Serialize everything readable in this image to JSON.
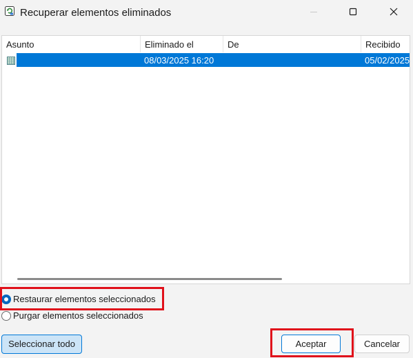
{
  "window": {
    "title": "Recuperar elementos eliminados",
    "icon": "recover-items-icon",
    "controls": [
      "minimize-icon",
      "maximize-icon",
      "close-icon"
    ]
  },
  "list": {
    "columns": [
      "Asunto",
      "Eliminado el",
      "De",
      "Recibido"
    ],
    "rows": [
      {
        "icon": "message-item-icon",
        "asunto": "",
        "eliminado_el": "08/03/2025 16:20",
        "de": "",
        "recibido": "05/02/2025",
        "selected": true
      }
    ]
  },
  "options": {
    "restore_label": "Restaurar elementos seleccionados",
    "purge_label": "Purgar elementos seleccionados",
    "selected": "restore"
  },
  "buttons": {
    "select_all": "Seleccionar todo",
    "accept": "Aceptar",
    "cancel": "Cancelar"
  },
  "colors": {
    "selection": "#0078d7",
    "annotation": "#e0101a",
    "accent": "#0067c0"
  }
}
